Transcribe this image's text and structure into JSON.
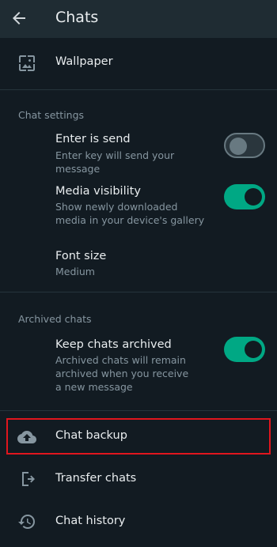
{
  "appbar": {
    "title": "Chats"
  },
  "items": {
    "wallpaper": {
      "label": "Wallpaper"
    },
    "chat_backup": {
      "label": "Chat backup"
    },
    "transfer_chats": {
      "label": "Transfer chats"
    },
    "chat_history": {
      "label": "Chat history"
    }
  },
  "chat_settings": {
    "title": "Chat settings",
    "enter_is_send": {
      "label": "Enter is send",
      "sub": "Enter key will send your message",
      "enabled": false
    },
    "media_visibility": {
      "label": "Media visibility",
      "sub": "Show newly downloaded media in your device's gallery",
      "enabled": true
    },
    "font_size": {
      "label": "Font size",
      "value": "Medium"
    }
  },
  "archived_chats": {
    "title": "Archived chats",
    "keep_archived": {
      "label": "Keep chats archived",
      "sub": "Archived chats will remain archived when you receive a new message",
      "enabled": true
    }
  },
  "colors": {
    "background": "#121b22",
    "appbar": "#1f2c33",
    "accent": "#00a884",
    "highlight": "#e0161e"
  }
}
